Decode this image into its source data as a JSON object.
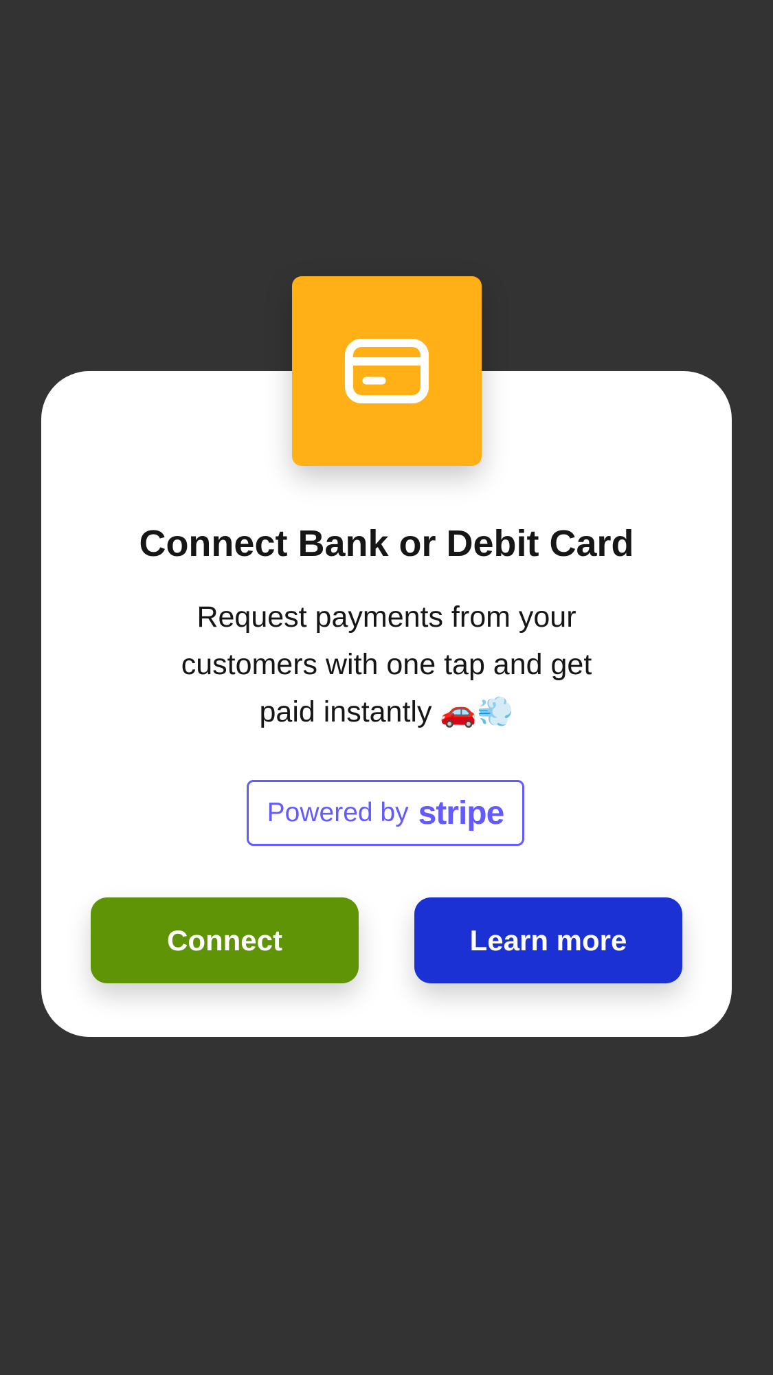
{
  "modal": {
    "icon": "credit-card-icon",
    "title": "Connect Bank or Debit Card",
    "description_line1": "Request payments from your",
    "description_line2": "customers with one tap and get",
    "description_line3": "paid instantly 🚗💨",
    "badge": {
      "powered_label": "Powered by",
      "brand_label": "stripe",
      "color": "#635bff"
    },
    "connect_label": "Connect",
    "learn_more_label": "Learn more"
  },
  "colors": {
    "background": "#333333",
    "icon_tile": "#ffb016",
    "connect_button": "#5e9406",
    "learn_more_button": "#1c31d4"
  }
}
